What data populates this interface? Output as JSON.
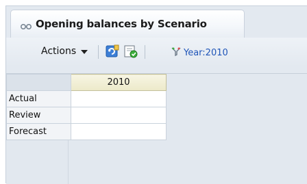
{
  "tab": {
    "title": "Opening balances by Scenario",
    "icon": "glasses-icon"
  },
  "toolbar": {
    "actions_label": "Actions",
    "refresh_icon": "refresh-icon",
    "save_icon": "save-icon",
    "filter_icon": "filter-icon",
    "year_filter": "Year:2010"
  },
  "grid": {
    "column_header": "2010",
    "rows": [
      {
        "label": "Actual",
        "value": ""
      },
      {
        "label": "Review",
        "value": ""
      },
      {
        "label": "Forecast",
        "value": ""
      }
    ]
  },
  "colors": {
    "accent_link": "#1f55b8",
    "header_bg": "#ece9c9",
    "panel_bg": "#e3e9f0"
  }
}
